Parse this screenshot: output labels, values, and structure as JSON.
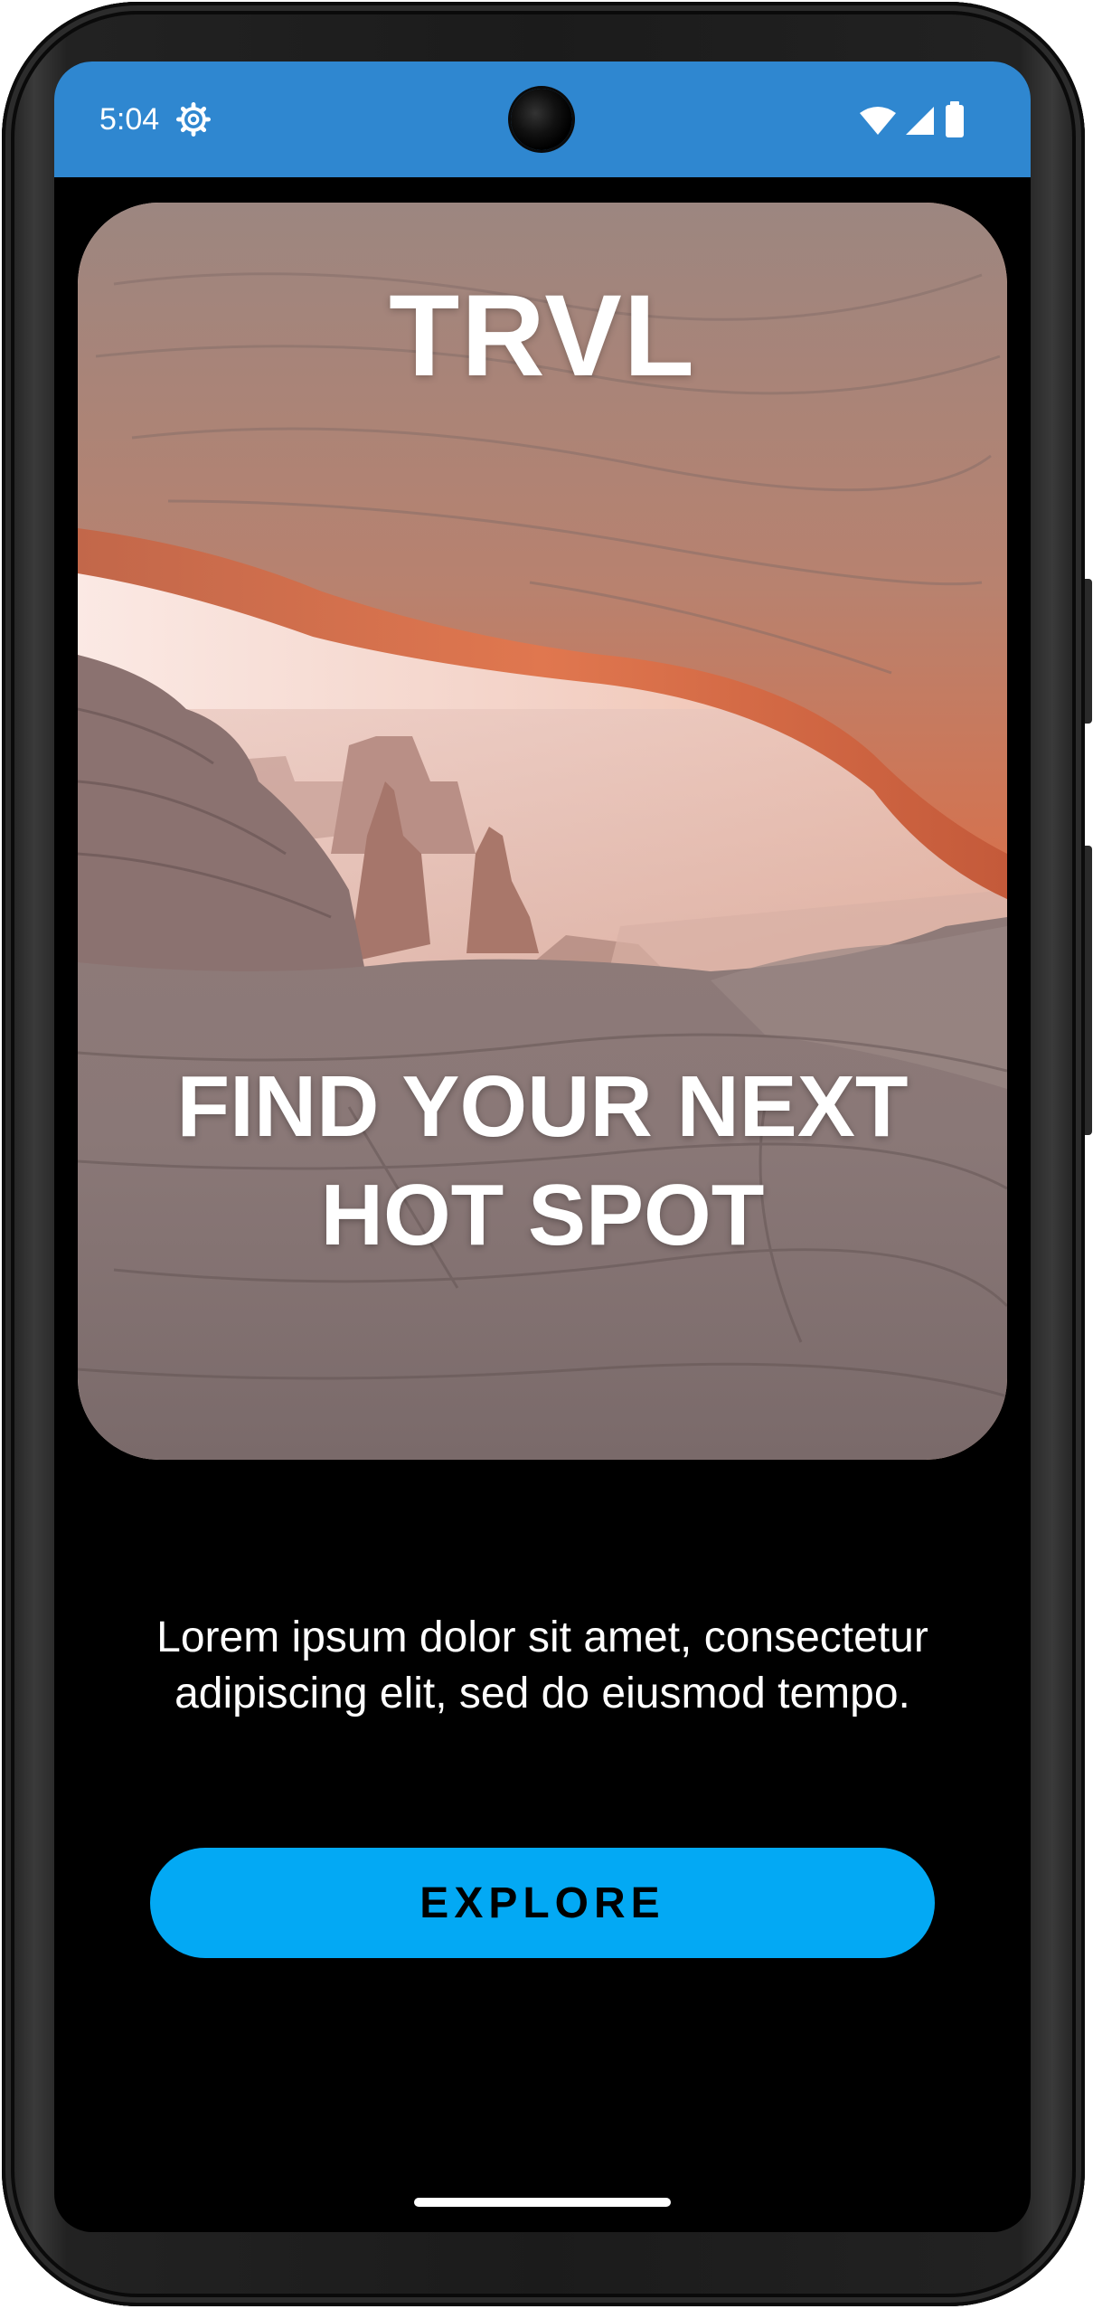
{
  "status_bar": {
    "time": "5:04",
    "color": "#2f87d0",
    "icons": [
      "gear-icon",
      "wifi-icon",
      "signal-icon",
      "battery-icon"
    ]
  },
  "hero": {
    "title": "TRVL",
    "tagline": "FIND YOUR NEXT\nHOT SPOT",
    "image": "desert-rock-arch-landscape"
  },
  "body": {
    "text": "Lorem ipsum dolor sit amet, consectetur adipiscing elit, sed do eiusmod tempo."
  },
  "cta": {
    "label": "EXPLORE",
    "color": "#03a9f4"
  }
}
